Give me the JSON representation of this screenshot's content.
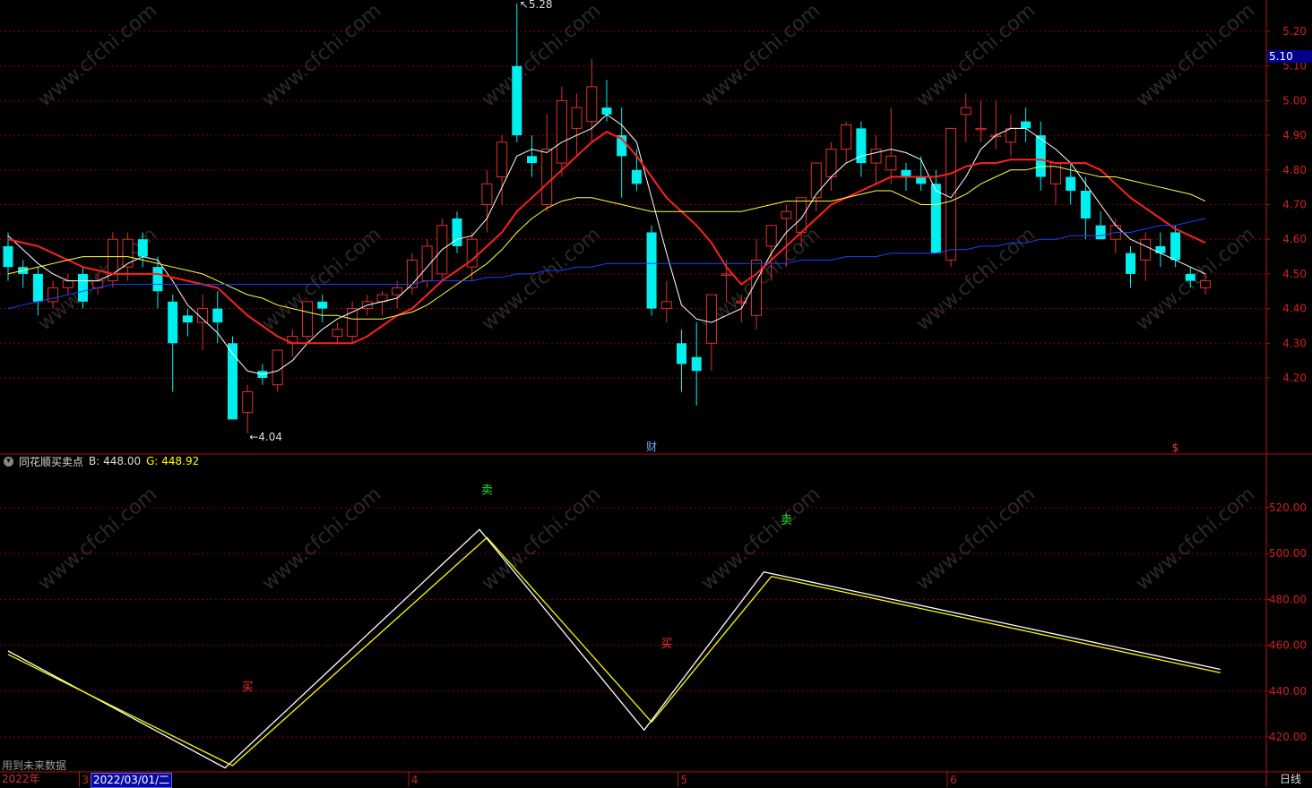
{
  "colors": {
    "up": "#e0302c",
    "down": "#00f0f0",
    "ma5": "#ffffff",
    "ma10": "#ff2020",
    "ma20": "#ffff40",
    "ma60": "#2040ff",
    "grid": "#8b0000",
    "axis_text": "#d02020"
  },
  "chart_data": [
    {
      "type": "candlestick",
      "ylim": [
        4.0,
        5.3
      ],
      "yticks": [
        "5.20",
        "5.10",
        "5.00",
        "4.90",
        "4.80",
        "4.70",
        "4.60",
        "4.50",
        "4.40",
        "4.30",
        "4.20"
      ],
      "max_label": "5.28",
      "min_label": "4.04",
      "last_price_badge": "5.10",
      "event_markers": [
        "财",
        "$"
      ],
      "ohlc": [
        [
          4.58,
          4.62,
          4.48,
          4.52
        ],
        [
          4.52,
          4.54,
          4.46,
          4.5
        ],
        [
          4.5,
          4.52,
          4.38,
          4.42
        ],
        [
          4.42,
          4.48,
          4.4,
          4.46
        ],
        [
          4.46,
          4.5,
          4.44,
          4.48
        ],
        [
          4.5,
          4.52,
          4.4,
          4.42
        ],
        [
          4.46,
          4.5,
          4.44,
          4.48
        ],
        [
          4.48,
          4.62,
          4.46,
          4.6
        ],
        [
          4.52,
          4.62,
          4.48,
          4.6
        ],
        [
          4.6,
          4.62,
          4.52,
          4.55
        ],
        [
          4.52,
          4.55,
          4.4,
          4.45
        ],
        [
          4.42,
          4.44,
          4.16,
          4.3
        ],
        [
          4.38,
          4.4,
          4.32,
          4.36
        ],
        [
          4.36,
          4.44,
          4.28,
          4.4
        ],
        [
          4.4,
          4.45,
          4.3,
          4.36
        ],
        [
          4.3,
          4.32,
          4.08,
          4.08
        ],
        [
          4.1,
          4.18,
          4.04,
          4.16
        ],
        [
          4.22,
          4.24,
          4.18,
          4.2
        ],
        [
          4.18,
          4.28,
          4.16,
          4.28
        ],
        [
          4.3,
          4.34,
          4.26,
          4.32
        ],
        [
          4.32,
          4.42,
          4.3,
          4.42
        ],
        [
          4.42,
          4.44,
          4.36,
          4.4
        ],
        [
          4.32,
          4.36,
          4.3,
          4.34
        ],
        [
          4.32,
          4.42,
          4.3,
          4.4
        ],
        [
          4.4,
          4.44,
          4.38,
          4.42
        ],
        [
          4.42,
          4.45,
          4.38,
          4.44
        ],
        [
          4.44,
          4.48,
          4.4,
          4.46
        ],
        [
          4.46,
          4.56,
          4.44,
          4.54
        ],
        [
          4.48,
          4.6,
          4.46,
          4.58
        ],
        [
          4.5,
          4.66,
          4.48,
          4.64
        ],
        [
          4.66,
          4.68,
          4.56,
          4.58
        ],
        [
          4.52,
          4.62,
          4.48,
          4.6
        ],
        [
          4.7,
          4.8,
          4.62,
          4.76
        ],
        [
          4.78,
          4.9,
          4.7,
          4.88
        ],
        [
          5.1,
          5.28,
          4.88,
          4.9
        ],
        [
          4.84,
          4.9,
          4.78,
          4.82
        ],
        [
          4.7,
          4.96,
          4.68,
          4.86
        ],
        [
          4.82,
          5.04,
          4.78,
          5.0
        ],
        [
          4.92,
          5.02,
          4.84,
          4.98
        ],
        [
          4.94,
          5.12,
          4.88,
          5.04
        ],
        [
          4.98,
          5.06,
          4.94,
          4.96
        ],
        [
          4.9,
          4.98,
          4.72,
          4.84
        ],
        [
          4.8,
          4.86,
          4.74,
          4.76
        ],
        [
          4.62,
          4.64,
          4.38,
          4.4
        ],
        [
          4.4,
          4.48,
          4.36,
          4.42
        ],
        [
          4.3,
          4.34,
          4.16,
          4.24
        ],
        [
          4.26,
          4.36,
          4.12,
          4.22
        ],
        [
          4.3,
          4.4,
          4.22,
          4.44
        ],
        [
          4.5,
          4.54,
          4.42,
          4.5
        ],
        [
          4.42,
          4.44,
          4.36,
          4.42
        ],
        [
          4.38,
          4.6,
          4.34,
          4.54
        ],
        [
          4.58,
          4.64,
          4.48,
          4.64
        ],
        [
          4.66,
          4.7,
          4.52,
          4.68
        ],
        [
          4.62,
          4.72,
          4.58,
          4.72
        ],
        [
          4.72,
          4.82,
          4.68,
          4.82
        ],
        [
          4.78,
          4.88,
          4.74,
          4.86
        ],
        [
          4.86,
          4.94,
          4.82,
          4.93
        ],
        [
          4.92,
          4.94,
          4.78,
          4.82
        ],
        [
          4.82,
          4.9,
          4.76,
          4.86
        ],
        [
          4.8,
          4.98,
          4.76,
          4.84
        ],
        [
          4.8,
          4.82,
          4.74,
          4.78
        ],
        [
          4.78,
          4.84,
          4.74,
          4.76
        ],
        [
          4.76,
          4.8,
          4.56,
          4.56
        ],
        [
          4.54,
          4.92,
          4.52,
          4.92
        ],
        [
          4.96,
          5.02,
          4.88,
          4.98
        ],
        [
          4.92,
          5.0,
          4.88,
          4.92
        ],
        [
          4.9,
          5.0,
          4.86,
          4.9
        ],
        [
          4.88,
          4.96,
          4.84,
          4.92
        ],
        [
          4.94,
          4.98,
          4.88,
          4.92
        ],
        [
          4.9,
          4.94,
          4.74,
          4.78
        ],
        [
          4.76,
          4.8,
          4.7,
          4.82
        ],
        [
          4.78,
          4.82,
          4.7,
          4.74
        ],
        [
          4.74,
          4.78,
          4.6,
          4.66
        ],
        [
          4.64,
          4.68,
          4.6,
          4.6
        ],
        [
          4.6,
          4.66,
          4.56,
          4.64
        ],
        [
          4.56,
          4.58,
          4.46,
          4.5
        ],
        [
          4.54,
          4.62,
          4.48,
          4.6
        ],
        [
          4.58,
          4.62,
          4.52,
          4.56
        ],
        [
          4.62,
          4.64,
          4.52,
          4.54
        ],
        [
          4.5,
          4.52,
          4.46,
          4.48
        ],
        [
          4.46,
          4.5,
          4.44,
          4.48
        ]
      ],
      "series": [
        {
          "name": "",
          "color": "#ffffff",
          "values": [
            4.61,
            4.57,
            4.53,
            4.5,
            4.48,
            4.48,
            4.48,
            4.5,
            4.53,
            4.55,
            4.54,
            4.48,
            4.41,
            4.37,
            4.33,
            4.27,
            4.22,
            4.21,
            4.22,
            4.25,
            4.3,
            4.34,
            4.37,
            4.39,
            4.41,
            4.42,
            4.43,
            4.47,
            4.52,
            4.57,
            4.6,
            4.61,
            4.66,
            4.75,
            4.84,
            4.86,
            4.85,
            4.88,
            4.9,
            4.92,
            4.96,
            4.93,
            4.88,
            4.72,
            4.56,
            4.41,
            4.37,
            4.36,
            4.38,
            4.4,
            4.48,
            4.56,
            4.62,
            4.66,
            4.73,
            4.78,
            4.82,
            4.84,
            4.85,
            4.86,
            4.85,
            4.83,
            4.74,
            4.72,
            4.78,
            4.86,
            4.9,
            4.92,
            4.92,
            4.89,
            4.86,
            4.82,
            4.76,
            4.7,
            4.64,
            4.6,
            4.58,
            4.56,
            4.54,
            4.52,
            4.5
          ]
        },
        {
          "name": "",
          "color": "#ff2020",
          "values": [
            4.6,
            4.59,
            4.58,
            4.56,
            4.54,
            4.52,
            4.51,
            4.5,
            4.5,
            4.5,
            4.5,
            4.49,
            4.48,
            4.47,
            4.46,
            4.42,
            4.38,
            4.35,
            4.32,
            4.3,
            4.3,
            4.3,
            4.3,
            4.3,
            4.32,
            4.35,
            4.38,
            4.4,
            4.44,
            4.48,
            4.51,
            4.54,
            4.58,
            4.62,
            4.68,
            4.72,
            4.76,
            4.8,
            4.84,
            4.88,
            4.91,
            4.89,
            4.84,
            4.78,
            4.72,
            4.68,
            4.64,
            4.59,
            4.52,
            4.47,
            4.5,
            4.54,
            4.58,
            4.62,
            4.66,
            4.7,
            4.72,
            4.74,
            4.76,
            4.78,
            4.78,
            4.78,
            4.78,
            4.79,
            4.81,
            4.82,
            4.82,
            4.83,
            4.83,
            4.83,
            4.82,
            4.82,
            4.82,
            4.8,
            4.76,
            4.72,
            4.69,
            4.66,
            4.63,
            4.61,
            4.59
          ]
        },
        {
          "name": "",
          "color": "#ffff40",
          "values": [
            4.5,
            4.51,
            4.52,
            4.53,
            4.54,
            4.55,
            4.55,
            4.55,
            4.55,
            4.54,
            4.53,
            4.52,
            4.51,
            4.5,
            4.48,
            4.46,
            4.44,
            4.43,
            4.41,
            4.4,
            4.39,
            4.38,
            4.38,
            4.37,
            4.37,
            4.37,
            4.38,
            4.39,
            4.41,
            4.44,
            4.47,
            4.5,
            4.53,
            4.57,
            4.62,
            4.66,
            4.69,
            4.71,
            4.72,
            4.72,
            4.71,
            4.7,
            4.69,
            4.68,
            4.68,
            4.68,
            4.68,
            4.68,
            4.68,
            4.68,
            4.69,
            4.7,
            4.71,
            4.71,
            4.71,
            4.71,
            4.72,
            4.73,
            4.74,
            4.74,
            4.72,
            4.7,
            4.7,
            4.71,
            4.73,
            4.76,
            4.78,
            4.8,
            4.8,
            4.81,
            4.81,
            4.8,
            4.79,
            4.78,
            4.78,
            4.77,
            4.76,
            4.75,
            4.74,
            4.73,
            4.71
          ]
        },
        {
          "name": "",
          "color": "#2040ff",
          "values": [
            4.4,
            4.41,
            4.42,
            4.43,
            4.44,
            4.45,
            4.46,
            4.47,
            4.47,
            4.47,
            4.47,
            4.47,
            4.47,
            4.47,
            4.47,
            4.47,
            4.47,
            4.47,
            4.47,
            4.47,
            4.47,
            4.47,
            4.47,
            4.47,
            4.47,
            4.47,
            4.47,
            4.47,
            4.48,
            4.48,
            4.48,
            4.48,
            4.49,
            4.49,
            4.5,
            4.5,
            4.51,
            4.51,
            4.52,
            4.52,
            4.53,
            4.53,
            4.53,
            4.53,
            4.53,
            4.53,
            4.53,
            4.53,
            4.53,
            4.53,
            4.53,
            4.53,
            4.53,
            4.54,
            4.54,
            4.54,
            4.55,
            4.55,
            4.55,
            4.56,
            4.56,
            4.56,
            4.56,
            4.57,
            4.57,
            4.58,
            4.58,
            4.59,
            4.59,
            4.6,
            4.6,
            4.61,
            4.61,
            4.61,
            4.62,
            4.62,
            4.63,
            4.64,
            4.64,
            4.65,
            4.66
          ]
        }
      ]
    },
    {
      "type": "line",
      "title": "同花顺买卖点",
      "ylim": [
        410,
        535
      ],
      "yticks": [
        "520.00",
        "500.00",
        "480.00",
        "460.00",
        "440.00",
        "420.00"
      ],
      "series": [
        {
          "name": "B",
          "color": "#ffffff",
          "points": [
            [
              0,
              457.5
            ],
            [
              14.5,
              406.5
            ],
            [
              31.5,
              510.5
            ],
            [
              42.5,
              423
            ],
            [
              50.5,
              492
            ],
            [
              81,
              449.5
            ]
          ]
        },
        {
          "name": "G",
          "color": "#ffff00",
          "points": [
            [
              0,
              456
            ],
            [
              15,
              407.5
            ],
            [
              32,
              507
            ],
            [
              43,
              426.5
            ],
            [
              51,
              490
            ],
            [
              81,
              448
            ]
          ]
        }
      ],
      "signals": [
        {
          "label": "卖",
          "type": "sell",
          "i": 32,
          "v": 528
        },
        {
          "label": "卖",
          "type": "sell",
          "i": 52,
          "v": 515
        },
        {
          "label": "买",
          "type": "buy",
          "i": 16,
          "v": 442
        },
        {
          "label": "买",
          "type": "buy",
          "i": 44,
          "v": 461
        }
      ]
    }
  ],
  "indicator_header": {
    "name": "同花顺买卖点",
    "b_text": "B: 448.00",
    "g_text": "G: 448.92"
  },
  "x_axis": {
    "year": "2022年",
    "date": "2022/03/01/二",
    "months": [
      {
        "label": "3",
        "i": 5
      },
      {
        "label": "4",
        "i": 27
      },
      {
        "label": "5",
        "i": 45
      },
      {
        "label": "6",
        "i": 63
      }
    ]
  },
  "future_note": "用到未来数据",
  "period_button": "日线",
  "watermark": "www.cfchi.com"
}
